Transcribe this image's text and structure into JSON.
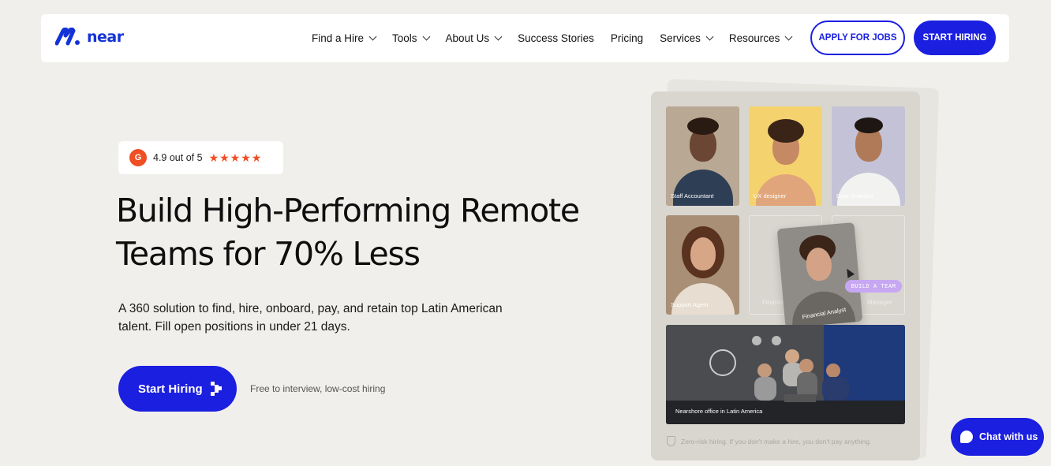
{
  "brand": {
    "name": "near",
    "color": "#1b1fe0"
  },
  "nav": {
    "items": [
      {
        "label": "Find a Hire",
        "dropdown": true
      },
      {
        "label": "Tools",
        "dropdown": true
      },
      {
        "label": "About Us",
        "dropdown": true
      },
      {
        "label": "Success Stories",
        "dropdown": false
      },
      {
        "label": "Pricing",
        "dropdown": false
      },
      {
        "label": "Services",
        "dropdown": true
      },
      {
        "label": "Resources",
        "dropdown": true
      }
    ],
    "apply_label": "APPLY FOR JOBS",
    "hire_label": "START HIRING"
  },
  "hero": {
    "rating": {
      "logo": "g2-icon",
      "text": "4.9 out of 5",
      "stars": "★★★★★"
    },
    "headline": "Build High-Performing Remote Teams for 70% Less",
    "subtext": "A 360 solution to find, hire, onboard, pay, and retain top Latin American talent. Fill open positions in under 21 days.",
    "cta_label": "Start Hiring",
    "cta_note": "Free to interview, low-cost hiring"
  },
  "showcase": {
    "tiles": [
      {
        "label": "Staff Accountant"
      },
      {
        "label": "UX designer"
      },
      {
        "label": "Data Scientist"
      },
      {
        "label": "Support Agent"
      }
    ],
    "ghost_left": "Financi",
    "ghost_right": "Manager",
    "floating_label": "Financial Analyst",
    "badge": "BUILD A TEAM",
    "office_label": "Nearshore office in Latin America",
    "footer": "Zero-risk hiring. If you don't make a hire, you don't pay anything."
  },
  "chat": {
    "label": "Chat with us"
  }
}
